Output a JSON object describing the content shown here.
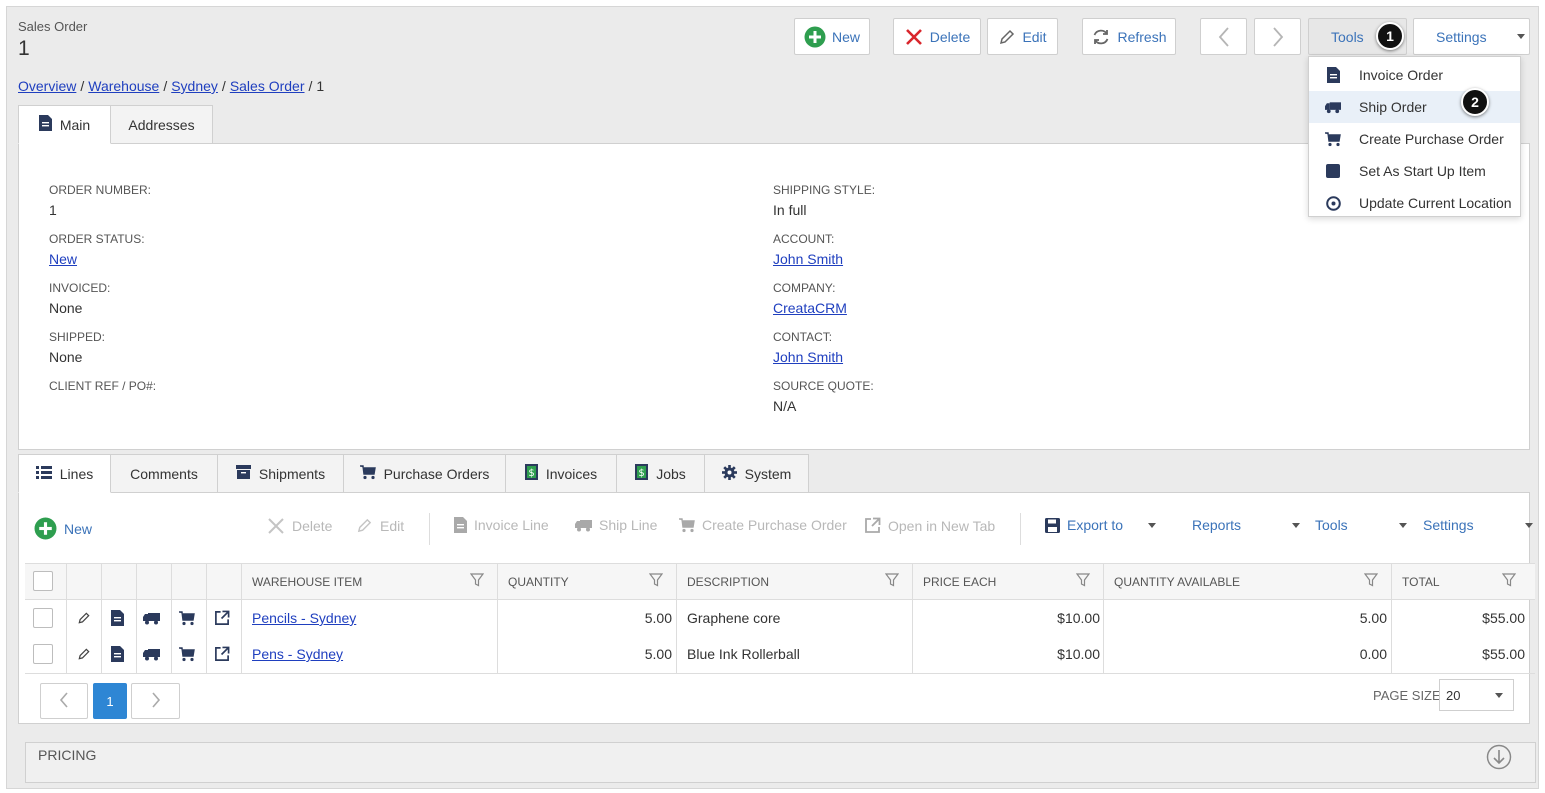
{
  "header": {
    "kind": "Sales Order",
    "number": "1"
  },
  "breadcrumb": {
    "items": [
      "Overview",
      "Warehouse",
      "Sydney",
      "Sales Order"
    ],
    "current": "1"
  },
  "toolbar": {
    "new": "New",
    "delete": "Delete",
    "edit": "Edit",
    "refresh": "Refresh",
    "tools": "Tools",
    "settings": "Settings"
  },
  "callouts": {
    "one": "1",
    "two": "2"
  },
  "tools_menu": [
    {
      "label": "Invoice Order",
      "icon": "document-icon"
    },
    {
      "label": "Ship Order",
      "icon": "truck-icon"
    },
    {
      "label": "Create Purchase Order",
      "icon": "cart-icon"
    },
    {
      "label": "Set As Start Up Item",
      "icon": "square-icon"
    },
    {
      "label": "Update Current Location",
      "icon": "compass-icon"
    }
  ],
  "top_tabs": {
    "main": "Main",
    "addresses": "Addresses"
  },
  "fields": {
    "order_number": {
      "label": "ORDER NUMBER:",
      "value": "1"
    },
    "order_status": {
      "label": "ORDER STATUS:",
      "value": "New"
    },
    "invoiced": {
      "label": "INVOICED:",
      "value": "None"
    },
    "shipped": {
      "label": "SHIPPED:",
      "value": "None"
    },
    "client_ref": {
      "label": "CLIENT REF / PO#:",
      "value": ""
    },
    "shipping_style": {
      "label": "SHIPPING STYLE:",
      "value": "In full"
    },
    "account": {
      "label": "ACCOUNT:",
      "value": "John Smith"
    },
    "company": {
      "label": "COMPANY:",
      "value": "CreataCRM"
    },
    "contact": {
      "label": "CONTACT:",
      "value": "John Smith"
    },
    "source_quote": {
      "label": "SOURCE QUOTE:",
      "value": "N/A"
    }
  },
  "bottom_tabs": {
    "lines": "Lines",
    "comments": "Comments",
    "shipments": "Shipments",
    "purchase_orders": "Purchase Orders",
    "invoices": "Invoices",
    "jobs": "Jobs",
    "system": "System"
  },
  "lines_toolbar": {
    "new": "New",
    "delete": "Delete",
    "edit": "Edit",
    "invoice_line": "Invoice Line",
    "ship_line": "Ship Line",
    "create_po": "Create Purchase Order",
    "open_new_tab": "Open in New Tab",
    "export_to": "Export to",
    "reports": "Reports",
    "tools": "Tools",
    "settings": "Settings"
  },
  "grid": {
    "columns": [
      "WAREHOUSE ITEM",
      "QUANTITY",
      "DESCRIPTION",
      "PRICE EACH",
      "QUANTITY AVAILABLE",
      "TOTAL"
    ],
    "rows": [
      {
        "item": "Pencils - Sydney",
        "quantity": "5.00",
        "description": "Graphene core",
        "price": "$10.00",
        "available": "5.00",
        "total": "$55.00"
      },
      {
        "item": "Pens - Sydney",
        "quantity": "5.00",
        "description": "Blue Ink Rollerball",
        "price": "$10.00",
        "available": "0.00",
        "total": "$55.00"
      }
    ]
  },
  "pager": {
    "current_page": "1",
    "page_size_label": "PAGE SIZE",
    "page_size": "20"
  },
  "pricing": {
    "label": "PRICING"
  },
  "colors": {
    "link": "#1f3fbf",
    "accent": "#3b73b9",
    "green": "#2e9e4f",
    "red": "#d9262c",
    "page_blue": "#2e86d4"
  }
}
